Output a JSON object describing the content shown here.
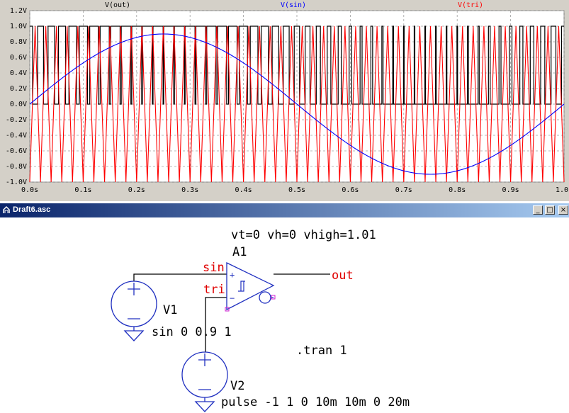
{
  "waveform": {
    "traces": [
      {
        "name": "V(out)",
        "color": "#000000"
      },
      {
        "name": "V(sin)",
        "color": "#0000ff"
      },
      {
        "name": "V(tri)",
        "color": "#ff0000"
      }
    ],
    "y_ticks": [
      "1.2V",
      "1.0V",
      "0.8V",
      "0.6V",
      "0.4V",
      "0.2V",
      "0.0V",
      "-0.2V",
      "-0.4V",
      "-0.6V",
      "-0.8V",
      "-1.0V"
    ],
    "x_ticks": [
      "0.0s",
      "0.1s",
      "0.2s",
      "0.3s",
      "0.4s",
      "0.5s",
      "0.6s",
      "0.7s",
      "0.8s",
      "0.9s",
      "1.0s"
    ],
    "colors": {
      "pane_bg": "#d4d0c8",
      "grid": "#a0a0a0",
      "plot_bg": "#ffffff"
    }
  },
  "chart_data": {
    "type": "line",
    "title": "",
    "xlabel": "",
    "ylabel": "",
    "xlim": [
      0.0,
      1.0
    ],
    "ylim": [
      -1.0,
      1.2
    ],
    "grid": true,
    "series": [
      {
        "name": "V(out)",
        "description_shape": "pwm square wave 0/1",
        "levels": [
          0,
          1
        ]
      },
      {
        "name": "V(sin)",
        "shape": "sine",
        "amplitude": 0.9,
        "frequency_hz": 1,
        "offset": 0
      },
      {
        "name": "V(tri)",
        "shape": "triangle",
        "low": -1,
        "high": 1,
        "period_s": 0.02
      }
    ]
  },
  "window": {
    "title": "Draft6.asc",
    "min_label": "_",
    "max_label": "□",
    "close_label": "×"
  },
  "schematic": {
    "directive_comparator": "vt=0 vh=0 vhigh=1.01",
    "instance_name": "A1",
    "net_sin": "sin",
    "net_tri": "tri",
    "net_out": "out",
    "v1_name": "V1",
    "v1_value": "sin 0 0.9 1",
    "v2_name": "V2",
    "v2_value": "pulse -1 1 0 10m 10m 0 20m",
    "tran_directive": ".tran 1",
    "plus_pin": "+",
    "minus_pin": "−"
  }
}
